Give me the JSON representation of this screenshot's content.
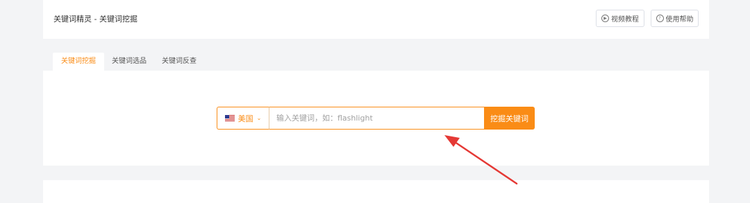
{
  "header": {
    "breadcrumb": "关键词精灵 - 关键词挖掘",
    "video_tutorial": "视频教程",
    "help": "使用帮助"
  },
  "tabs": [
    {
      "label": "关键词挖掘",
      "active": true
    },
    {
      "label": "关键词选品",
      "active": false
    },
    {
      "label": "关键词反查",
      "active": false
    }
  ],
  "search": {
    "country": "美国",
    "placeholder": "输入关键词，如：flashlight",
    "value": "",
    "submit_label": "挖掘关键词"
  },
  "colors": {
    "accent": "#fa8c16",
    "annotation_arrow": "#e53935"
  }
}
